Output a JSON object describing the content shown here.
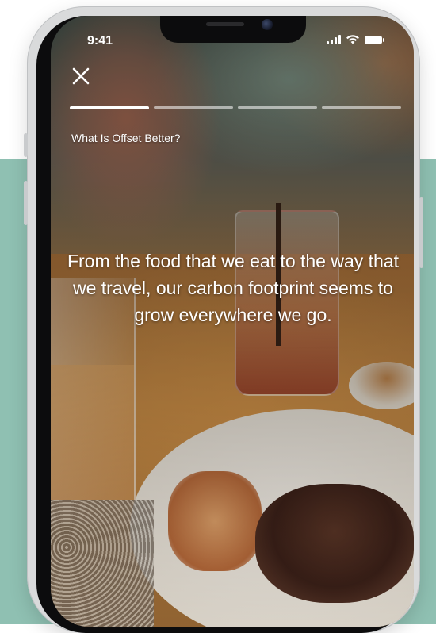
{
  "status_bar": {
    "time": "9:41",
    "icons": [
      "signal-icon",
      "wifi-icon",
      "battery-icon"
    ]
  },
  "story": {
    "close_icon": "close-icon",
    "progress": {
      "total_segments": 4,
      "active_segment": 1
    },
    "title": "What Is Offset Better?",
    "body": "From the food that we eat to the way that we travel, our carbon footprint seems to grow everywhere we go."
  },
  "colors": {
    "backdrop": "#8fc0b2",
    "text": "#ffffff",
    "progress_active": "#ffffff",
    "progress_inactive": "rgba(255,255,255,0.55)"
  }
}
